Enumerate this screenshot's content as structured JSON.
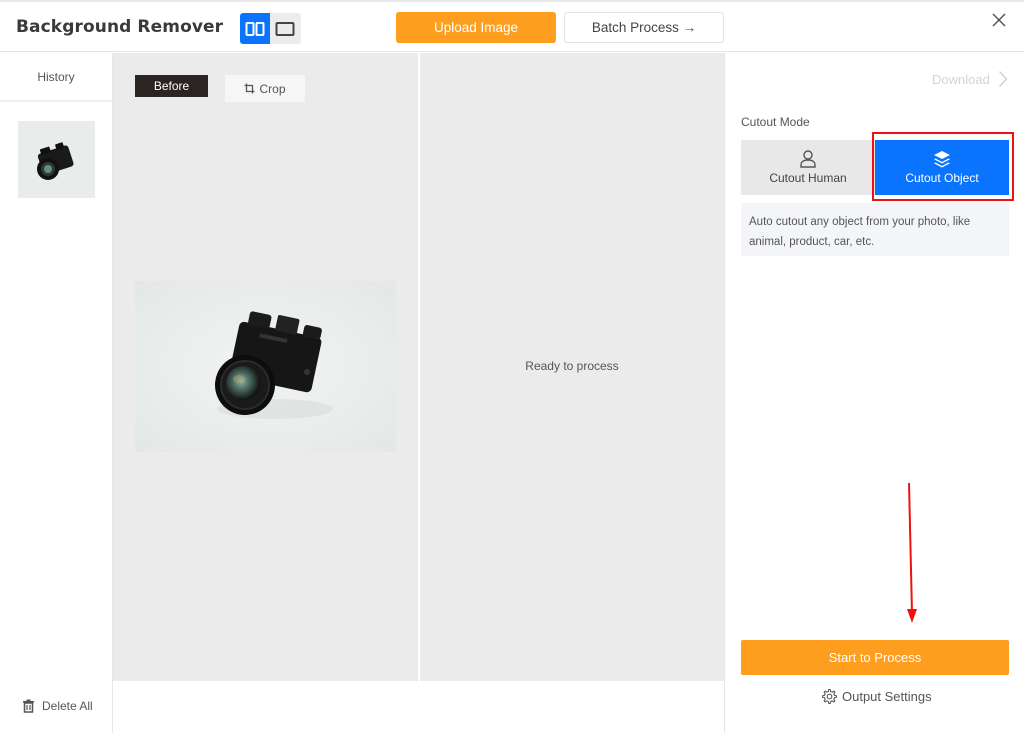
{
  "header": {
    "app_title": "Background Remover",
    "view_modes": [
      {
        "name": "split-view",
        "icon": "split-view-icon",
        "active": true
      },
      {
        "name": "single-view",
        "icon": "single-view-icon",
        "active": false
      }
    ],
    "upload_label": "Upload Image",
    "batch_label": "Batch Process →",
    "close_icon": "close-icon"
  },
  "history": {
    "title": "History",
    "items": [
      {
        "thumbnail": "camera-photo",
        "selected": true
      }
    ],
    "delete_all_label": "Delete All"
  },
  "canvas": {
    "before_label": "Before",
    "crop_label": "Crop",
    "source_image": "black mirrorless camera on white background",
    "result_status": "Ready to process"
  },
  "panel": {
    "download_label": "Download",
    "cutout_mode_label": "Cutout Mode",
    "modes": [
      {
        "label": "Cutout Human",
        "icon": "person-icon",
        "selected": false
      },
      {
        "label": "Cutout Object",
        "icon": "layers-icon",
        "selected": true
      }
    ],
    "mode_description": "Auto cutout any object from your photo, like animal, product, car, etc.",
    "start_label": "Start to Process",
    "output_settings_label": "Output Settings"
  },
  "colors": {
    "accent_blue": "#0a74ff",
    "accent_orange": "#fd9e1f",
    "annotation_red": "#ee1111"
  }
}
